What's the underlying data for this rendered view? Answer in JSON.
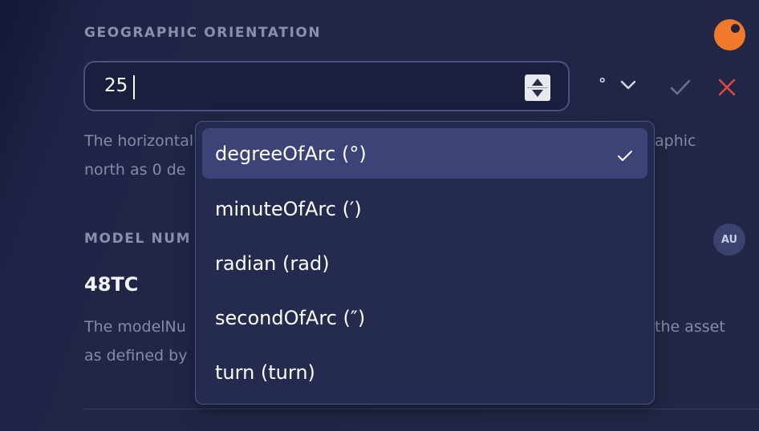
{
  "orientation": {
    "label": "GEOGRAPHIC ORIENTATION",
    "value": "25",
    "unit_symbol": "°",
    "description_lines": [
      "The horizontal",
      "north as 0 de"
    ],
    "description_right": "aphic"
  },
  "model": {
    "label": "MODEL NUM",
    "value": "48TC",
    "description_lines": [
      "The modelNu",
      "as defined by"
    ],
    "description_right": "the asset",
    "avatar_initials": "AU"
  },
  "unit_dropdown": {
    "selected_index": 0,
    "options": [
      {
        "label": "degreeOfArc (°)"
      },
      {
        "label": "minuteOfArc (′)"
      },
      {
        "label": "radian (rad)"
      },
      {
        "label": "secondOfArc (″)"
      },
      {
        "label": "turn (turn)"
      }
    ]
  },
  "colors": {
    "accent_orange": "#f07a2a",
    "cancel_red": "#e0473f",
    "confirm_gray": "#6d7190",
    "selected_bg": "#3c4377"
  },
  "icons": {
    "confirm": "check-icon",
    "cancel": "close-icon",
    "dropdown": "chevron-down-icon",
    "selected": "check-icon"
  }
}
